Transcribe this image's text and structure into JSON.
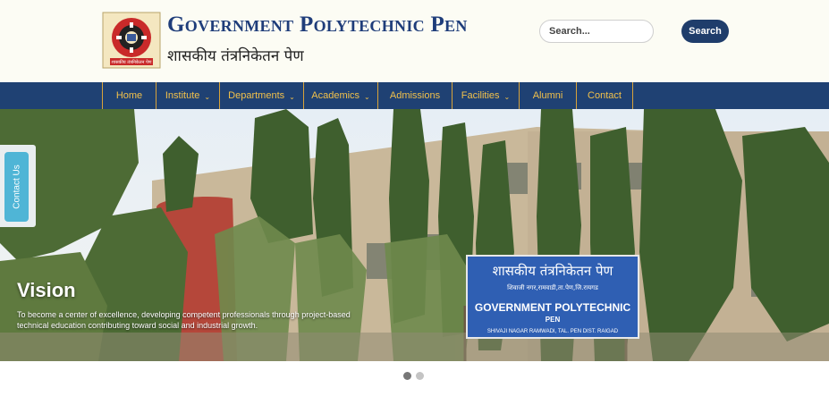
{
  "header": {
    "title": "Government Polytechnic Pen",
    "subtitle": "शासकीय तंत्रनिकेतन पेण",
    "logo_text": "शासकीय तंत्रनिकेतन पेण"
  },
  "search": {
    "placeholder": "Search...",
    "button_label": "Search"
  },
  "nav": {
    "items": [
      {
        "label": "Home",
        "dropdown": false
      },
      {
        "label": "Institute",
        "dropdown": true
      },
      {
        "label": "Departments",
        "dropdown": true
      },
      {
        "label": "Academics",
        "dropdown": true
      },
      {
        "label": "Admissions",
        "dropdown": false
      },
      {
        "label": "Facilities",
        "dropdown": true
      },
      {
        "label": "Alumni",
        "dropdown": false
      },
      {
        "label": "Contact",
        "dropdown": false
      }
    ],
    "caret": "⌄"
  },
  "hero": {
    "heading": "Vision",
    "text": "To become a center of excellence, developing competent professionals through project-based technical education contributing toward social and industrial growth.",
    "signboard": {
      "line1": "शासकीय तंत्रनिकेतन पेण",
      "line2": "शिवाजी नगर,रामवाडी,ता.पेण,जि.रायगड",
      "line3": "GOVERNMENT POLYTECHNIC",
      "line4": "PEN",
      "line5": "SHIVAJI NAGAR RAMWADI, TAL. PEN DIST. RAIGAD"
    }
  },
  "contact_tab": {
    "label": "Contact Us"
  },
  "slider": {
    "count": 2,
    "active": 0
  },
  "colors": {
    "nav_bg": "#1f4173",
    "nav_text": "#f2c14b",
    "title": "#1f3d7a",
    "search_button": "#1f3d6b",
    "contact_tab": "#4fb5d6"
  }
}
